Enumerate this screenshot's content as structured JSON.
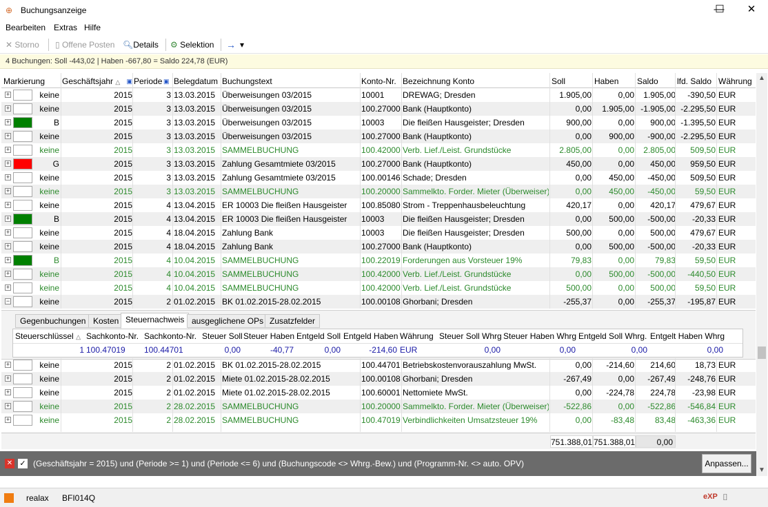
{
  "window": {
    "title": "Buchungsanzeige",
    "minimize": "—",
    "maximize": "☐",
    "close": "✕"
  },
  "menu": [
    "Bearbeiten",
    "Extras",
    "Hilfe"
  ],
  "toolbar": {
    "storno": "Storno",
    "offene_posten": "Offene Posten",
    "details": "Details",
    "selektion": "Selektion",
    "arrow": "→",
    "dropdown": "▾"
  },
  "summary": "4 Buchungen: Soll -443,02 | Haben -667,80 = Saldo 224,78 (EUR)",
  "columns": [
    "Markierung",
    "Geschäftsjahr",
    "Periode",
    "Belegdatum",
    "Buchungstext",
    "Konto-Nr.",
    "Bezeichnung Konto",
    "Soll",
    "Haben",
    "Saldo",
    "lfd. Saldo",
    "Währung"
  ],
  "rows_top": [
    {
      "mark": "keine",
      "color": "#ffffff",
      "jahr": "2015",
      "periode": "3",
      "datum": "13.03.2015",
      "text": "Überweisungen 03/2015",
      "konto": "10001",
      "bez": "DREWAG; Dresden",
      "soll": "1.905,00",
      "haben": "0,00",
      "saldo": "1.905,00",
      "lfd": "-390,50",
      "waehrung": "EUR",
      "green": false,
      "exp": "+"
    },
    {
      "mark": "keine",
      "color": "#ffffff",
      "jahr": "2015",
      "periode": "3",
      "datum": "13.03.2015",
      "text": "Überweisungen 03/2015",
      "konto": "100.27000",
      "bez": "Bank (Hauptkonto)",
      "soll": "0,00",
      "haben": "1.905,00",
      "saldo": "-1.905,00",
      "lfd": "-2.295,50",
      "waehrung": "EUR",
      "green": false,
      "exp": "+"
    },
    {
      "mark": "B",
      "color": "#008000",
      "jahr": "2015",
      "periode": "3",
      "datum": "13.03.2015",
      "text": "Überweisungen 03/2015",
      "konto": "10003",
      "bez": "Die fleißen Hausgeister; Dresden",
      "soll": "900,00",
      "haben": "0,00",
      "saldo": "900,00",
      "lfd": "-1.395,50",
      "waehrung": "EUR",
      "green": false,
      "exp": "+"
    },
    {
      "mark": "keine",
      "color": "#ffffff",
      "jahr": "2015",
      "periode": "3",
      "datum": "13.03.2015",
      "text": "Überweisungen 03/2015",
      "konto": "100.27000",
      "bez": "Bank (Hauptkonto)",
      "soll": "0,00",
      "haben": "900,00",
      "saldo": "-900,00",
      "lfd": "-2.295,50",
      "waehrung": "EUR",
      "green": false,
      "exp": "+"
    },
    {
      "mark": "keine",
      "color": "#ffffff",
      "jahr": "2015",
      "periode": "3",
      "datum": "13.03.2015",
      "text": "SAMMELBUCHUNG",
      "konto": "100.42000",
      "bez": "Verb. Lief./Leist. Grundstücke",
      "soll": "2.805,00",
      "haben": "0,00",
      "saldo": "2.805,00",
      "lfd": "509,50",
      "waehrung": "EUR",
      "green": true,
      "exp": "+"
    },
    {
      "mark": "G",
      "color": "#ff0000",
      "jahr": "2015",
      "periode": "3",
      "datum": "13.03.2015",
      "text": "Zahlung Gesamtmiete 03/2015",
      "konto": "100.27000",
      "bez": "Bank (Hauptkonto)",
      "soll": "450,00",
      "haben": "0,00",
      "saldo": "450,00",
      "lfd": "959,50",
      "waehrung": "EUR",
      "green": false,
      "exp": "+"
    },
    {
      "mark": "keine",
      "color": "#ffffff",
      "jahr": "2015",
      "periode": "3",
      "datum": "13.03.2015",
      "text": "Zahlung Gesamtmiete 03/2015",
      "konto": "100.00146",
      "bez": "Schade; Dresden",
      "soll": "0,00",
      "haben": "450,00",
      "saldo": "-450,00",
      "lfd": "509,50",
      "waehrung": "EUR",
      "green": false,
      "exp": "+"
    },
    {
      "mark": "keine",
      "color": "#ffffff",
      "jahr": "2015",
      "periode": "3",
      "datum": "13.03.2015",
      "text": "SAMMELBUCHUNG",
      "konto": "100.20000",
      "bez": "Sammelkto. Forder. Mieter (Überweiser)",
      "soll": "0,00",
      "haben": "450,00",
      "saldo": "-450,00",
      "lfd": "59,50",
      "waehrung": "EUR",
      "green": true,
      "exp": "+"
    },
    {
      "mark": "keine",
      "color": "#ffffff",
      "jahr": "2015",
      "periode": "4",
      "datum": "13.04.2015",
      "text": "ER 10003 Die fleißen Hausgeister",
      "konto": "100.85080",
      "bez": "Strom - Treppenhausbeleuchtung",
      "soll": "420,17",
      "haben": "0,00",
      "saldo": "420,17",
      "lfd": "479,67",
      "waehrung": "EUR",
      "green": false,
      "exp": "+"
    },
    {
      "mark": "B",
      "color": "#008000",
      "jahr": "2015",
      "periode": "4",
      "datum": "13.04.2015",
      "text": "ER 10003 Die fleißen Hausgeister",
      "konto": "10003",
      "bez": "Die fleißen Hausgeister; Dresden",
      "soll": "0,00",
      "haben": "500,00",
      "saldo": "-500,00",
      "lfd": "-20,33",
      "waehrung": "EUR",
      "green": false,
      "exp": "+"
    },
    {
      "mark": "keine",
      "color": "#ffffff",
      "jahr": "2015",
      "periode": "4",
      "datum": "18.04.2015",
      "text": "Zahlung Bank",
      "konto": "10003",
      "bez": "Die fleißen Hausgeister; Dresden",
      "soll": "500,00",
      "haben": "0,00",
      "saldo": "500,00",
      "lfd": "479,67",
      "waehrung": "EUR",
      "green": false,
      "exp": "+"
    },
    {
      "mark": "keine",
      "color": "#ffffff",
      "jahr": "2015",
      "periode": "4",
      "datum": "18.04.2015",
      "text": "Zahlung Bank",
      "konto": "100.27000",
      "bez": "Bank (Hauptkonto)",
      "soll": "0,00",
      "haben": "500,00",
      "saldo": "-500,00",
      "lfd": "-20,33",
      "waehrung": "EUR",
      "green": false,
      "exp": "+"
    },
    {
      "mark": "B",
      "color": "#008000",
      "jahr": "2015",
      "periode": "4",
      "datum": "10.04.2015",
      "text": "SAMMELBUCHUNG",
      "konto": "100.22019",
      "bez": "Forderungen aus Vorsteuer 19%",
      "soll": "79,83",
      "haben": "0,00",
      "saldo": "79,83",
      "lfd": "59,50",
      "waehrung": "EUR",
      "green": true,
      "exp": "+"
    },
    {
      "mark": "keine",
      "color": "#ffffff",
      "jahr": "2015",
      "periode": "4",
      "datum": "10.04.2015",
      "text": "SAMMELBUCHUNG",
      "konto": "100.42000",
      "bez": "Verb. Lief./Leist. Grundstücke",
      "soll": "0,00",
      "haben": "500,00",
      "saldo": "-500,00",
      "lfd": "-440,50",
      "waehrung": "EUR",
      "green": true,
      "exp": "+"
    },
    {
      "mark": "keine",
      "color": "#ffffff",
      "jahr": "2015",
      "periode": "4",
      "datum": "10.04.2015",
      "text": "SAMMELBUCHUNG",
      "konto": "100.42000",
      "bez": "Verb. Lief./Leist. Grundstücke",
      "soll": "500,00",
      "haben": "0,00",
      "saldo": "500,00",
      "lfd": "59,50",
      "waehrung": "EUR",
      "green": true,
      "exp": "+"
    },
    {
      "mark": "keine",
      "color": "#ffffff",
      "jahr": "2015",
      "periode": "2",
      "datum": "01.02.2015",
      "text": "BK 01.02.2015-28.02.2015",
      "konto": "100.00108",
      "bez": "Ghorbani; Dresden",
      "soll": "-255,37",
      "haben": "0,00",
      "saldo": "-255,37",
      "lfd": "-195,87",
      "waehrung": "EUR",
      "green": false,
      "exp": "−"
    }
  ],
  "tabs": [
    "Gegenbuchungen",
    "Kosten",
    "Steuernachweis",
    "ausgeglichene OPs",
    "Zusatzfelder"
  ],
  "sub_columns": [
    "Steuerschlüssel",
    "Sachkonto-Nr.",
    "Sachkonto-Nr.",
    "Steuer Soll",
    "Steuer Haben",
    "Entgeld Soll",
    "Entgeld Haben",
    "Währung",
    "Steuer Soll Whrg",
    "Steuer Haben Whrg",
    "Entgeld Soll Whrg.",
    "Entgelt Haben Whrg"
  ],
  "sub_values": [
    "1",
    "100.47019",
    "100.44701",
    "0,00",
    "-40,77",
    "0,00",
    "-214,60",
    "EUR",
    "0,00",
    "0,00",
    "0,00",
    "0,00"
  ],
  "rows_bottom": [
    {
      "mark": "keine",
      "color": "#ffffff",
      "jahr": "2015",
      "periode": "2",
      "datum": "01.02.2015",
      "text": "BK 01.02.2015-28.02.2015",
      "konto": "100.44701",
      "bez": "Betriebskostenvorauszahlung MwSt.",
      "soll": "0,00",
      "haben": "-214,60",
      "saldo": "214,60",
      "lfd": "18,73",
      "waehrung": "EUR",
      "green": false,
      "exp": "+"
    },
    {
      "mark": "keine",
      "color": "#ffffff",
      "jahr": "2015",
      "periode": "2",
      "datum": "01.02.2015",
      "text": "Miete 01.02.2015-28.02.2015",
      "konto": "100.00108",
      "bez": "Ghorbani; Dresden",
      "soll": "-267,49",
      "haben": "0,00",
      "saldo": "-267,49",
      "lfd": "-248,76",
      "waehrung": "EUR",
      "green": false,
      "exp": "+"
    },
    {
      "mark": "keine",
      "color": "#ffffff",
      "jahr": "2015",
      "periode": "2",
      "datum": "01.02.2015",
      "text": "Miete 01.02.2015-28.02.2015",
      "konto": "100.60001",
      "bez": "Nettomiete MwSt.",
      "soll": "0,00",
      "haben": "-224,78",
      "saldo": "224,78",
      "lfd": "-23,98",
      "waehrung": "EUR",
      "green": false,
      "exp": "+"
    },
    {
      "mark": "keine",
      "color": "#ffffff",
      "jahr": "2015",
      "periode": "2",
      "datum": "28.02.2015",
      "text": "SAMMELBUCHUNG",
      "konto": "100.20000",
      "bez": "Sammelkto. Forder. Mieter (Überweiser)",
      "soll": "-522,86",
      "haben": "0,00",
      "saldo": "-522,86",
      "lfd": "-546,84",
      "waehrung": "EUR",
      "green": true,
      "exp": "+"
    },
    {
      "mark": "keine",
      "color": "#ffffff",
      "jahr": "2015",
      "periode": "2",
      "datum": "28.02.2015",
      "text": "SAMMELBUCHUNG",
      "konto": "100.47019",
      "bez": "Verbindlichkeiten Umsatzsteuer 19%",
      "soll": "0,00",
      "haben": "-83,48",
      "saldo": "83,48",
      "lfd": "-463,36",
      "waehrung": "EUR",
      "green": true,
      "exp": "+"
    }
  ],
  "totals": {
    "soll": "751.388,01",
    "haben": "751.388,01",
    "saldo": "0,00"
  },
  "filter": {
    "text": "(Geschäftsjahr = 2015) und (Periode >= 1) und (Periode <= 6) und (Buchungscode <> Whrg.-Bew.) und (Programm-Nr. <> auto. OPV)",
    "button": "Anpassen..."
  },
  "statusbar": {
    "company": "realax",
    "code": "BFI014Q"
  }
}
